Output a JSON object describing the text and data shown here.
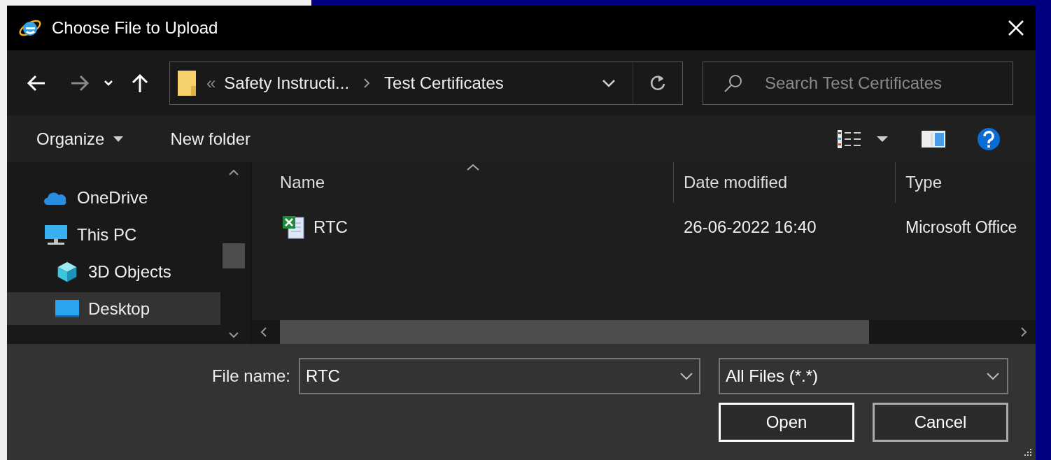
{
  "window": {
    "title": "Choose File to Upload"
  },
  "address_bar": {
    "overflow": "«",
    "path": [
      "Safety Instructi...",
      "Test Certificates"
    ]
  },
  "search": {
    "placeholder": "Search Test Certificates"
  },
  "toolbar": {
    "organize": "Organize",
    "new_folder": "New folder"
  },
  "nav_pane": [
    {
      "label": "OneDrive",
      "kind": "cloud",
      "selected": false
    },
    {
      "label": "This PC",
      "kind": "pc",
      "selected": false,
      "children": [
        {
          "label": "3D Objects",
          "kind": "cube",
          "selected": false
        },
        {
          "label": "Desktop",
          "kind": "desktop",
          "selected": true
        }
      ]
    }
  ],
  "file_list": {
    "columns": [
      "Name",
      "Date modified",
      "Type"
    ],
    "rows": [
      {
        "name": "RTC",
        "date_modified": "26-06-2022 16:40",
        "type": "Microsoft Office"
      }
    ]
  },
  "file_name": {
    "label": "File name:",
    "value": "RTC"
  },
  "file_type": {
    "value": "All Files (*.*)"
  },
  "buttons": [
    "Open",
    "Cancel"
  ]
}
